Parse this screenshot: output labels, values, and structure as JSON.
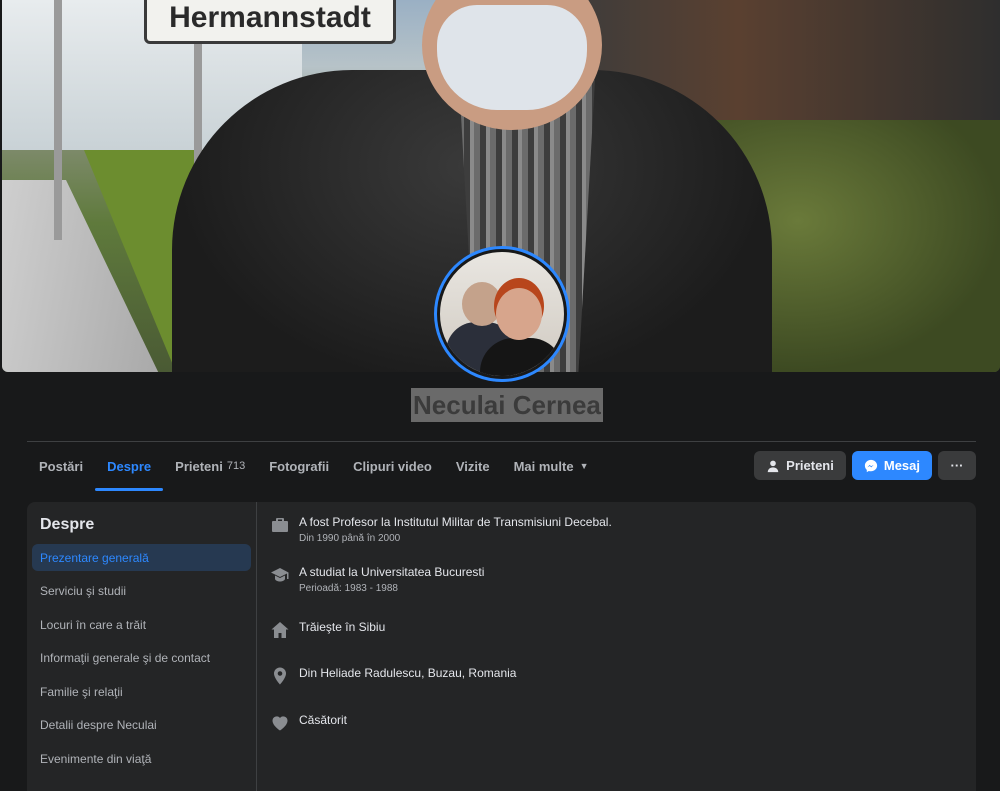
{
  "cover": {
    "sign_text": "Hermannstadt"
  },
  "profile": {
    "name": "Neculai Cernea"
  },
  "tabs": [
    {
      "label": "Postări"
    },
    {
      "label": "Despre",
      "active": true
    },
    {
      "label": "Prieteni",
      "count": "713"
    },
    {
      "label": "Fotografii"
    },
    {
      "label": "Clipuri video"
    },
    {
      "label": "Vizite"
    },
    {
      "label": "Mai multe"
    }
  ],
  "actions": {
    "friends_label": "Prieteni",
    "message_label": "Mesaj",
    "more_label": "···"
  },
  "about": {
    "title": "Despre",
    "nav": [
      {
        "label": "Prezentare generală"
      },
      {
        "label": "Serviciu şi studii"
      },
      {
        "label": "Locuri în care a trăit"
      },
      {
        "label": "Informaţii generale şi de contact"
      },
      {
        "label": "Familie şi relaţii"
      },
      {
        "label": "Detalii despre Neculai"
      },
      {
        "label": "Evenimente din viaţă"
      }
    ],
    "items": [
      {
        "icon": "briefcase-icon",
        "text": "A fost Profesor la Institutul Militar de Transmisiuni Decebal.",
        "sub": "Din 1990 până în 2000"
      },
      {
        "icon": "graduation-cap-icon",
        "text": "A studiat la Universitatea Bucuresti",
        "sub": "Perioadă: 1983 - 1988"
      },
      {
        "icon": "home-icon",
        "text": "Trăieşte în Sibiu"
      },
      {
        "icon": "location-pin-icon",
        "text": "Din Heliade Radulescu, Buzau, Romania"
      },
      {
        "icon": "heart-icon",
        "text": "Căsătorit"
      }
    ]
  },
  "colors": {
    "accent": "#2d88ff",
    "background": "#18191a",
    "card": "#242526"
  }
}
